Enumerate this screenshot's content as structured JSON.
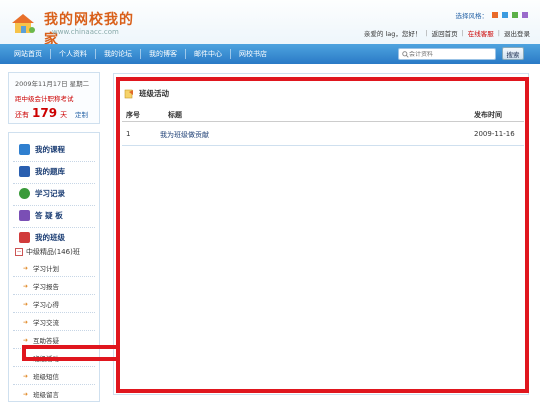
{
  "header": {
    "site_title": "我的网校我的家",
    "site_url": "www.chinaacc.com",
    "style_label": "选择风格：",
    "style_colors": [
      "#e86a2a",
      "#3a9be0",
      "#5bb048",
      "#9a6acb"
    ],
    "greeting": "亲爱的 lag，您好！",
    "links": [
      "返回首页",
      "在线客服",
      "退出登录"
    ]
  },
  "nav": {
    "items": [
      "网站首页",
      "个人资料",
      "我的论坛",
      "我的博客",
      "邮件中心",
      "网校书店"
    ],
    "search_placeholder": "会计资料",
    "search_button": "搜索"
  },
  "sidebar": {
    "date": "2009年11月17日 星期二",
    "exam": "距中级会计职称考试",
    "remain_prefix": "还有",
    "remain_days": "179",
    "remain_suffix": "天",
    "set_label": "定制",
    "menu": [
      {
        "label": "我的课程",
        "icon": "course-icon",
        "color": "#2f7fcf"
      },
      {
        "label": "我的题库",
        "icon": "question-bank-icon",
        "color": "#2a5fb0"
      },
      {
        "label": "学习记录",
        "icon": "record-icon",
        "color": "#3a9a3a"
      },
      {
        "label": "答 疑 板",
        "icon": "question-icon",
        "color": "#7a4fb5"
      },
      {
        "label": "我的班级",
        "icon": "class-icon",
        "color": "#d13b3b"
      }
    ],
    "class_name": "中级精品(146)班",
    "sub_items": [
      "学习计划",
      "学习报告",
      "学习心得",
      "学习交流",
      "互助答疑",
      "班级活动",
      "班级短信",
      "班级留言"
    ]
  },
  "main": {
    "heading": "班级活动",
    "columns": [
      "序号",
      "标题",
      "发布时间"
    ],
    "rows": [
      {
        "no": "1",
        "title": "我为班级做贡献",
        "date": "2009-11-16"
      }
    ]
  },
  "colors": {
    "highlight": "#e0161e",
    "nav": "#2a7ac6",
    "accent": "#c00"
  }
}
